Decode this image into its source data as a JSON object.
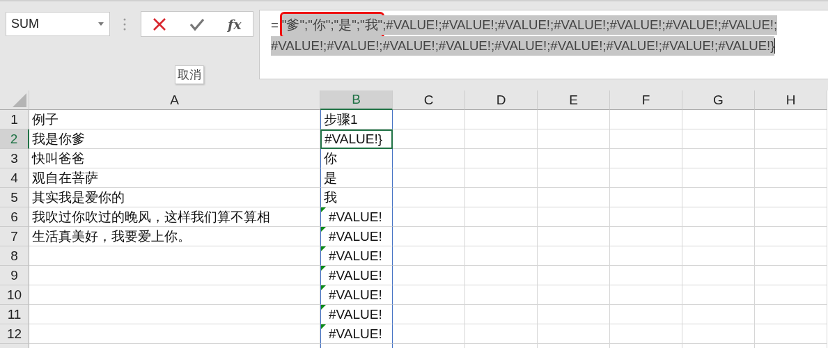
{
  "name_box": {
    "value": "SUM"
  },
  "formula_buttons": [
    {
      "kind": "cancel"
    },
    {
      "kind": "enter"
    },
    {
      "kind": "function",
      "label": "fx"
    }
  ],
  "tooltip": "取消",
  "formula_bar": {
    "prefix": "=",
    "boxed": "\"爹\";\"你\";\"是\";\"我\"",
    "lines": [
      ";#VALUE!;#VALUE!;#VALUE!;#VALUE!;#VALUE!;#VALUE!;#VALUE!;",
      "#VALUE!;#VALUE!;#VALUE!;#VALUE!;#VALUE!;#VALUE!;#VALUE!;#VALUE!;#VALUE!}"
    ]
  },
  "columns": [
    {
      "label": "A",
      "selected": false
    },
    {
      "label": "B",
      "selected": true
    },
    {
      "label": "C",
      "selected": false
    },
    {
      "label": "D",
      "selected": false
    },
    {
      "label": "E",
      "selected": false
    },
    {
      "label": "F",
      "selected": false
    },
    {
      "label": "G",
      "selected": false
    },
    {
      "label": "H",
      "selected": false
    }
  ],
  "rows": [
    {
      "label": "1",
      "selected": false,
      "a": "例子",
      "b": "步骤1",
      "b_active": false,
      "b_error_flag": false
    },
    {
      "label": "2",
      "selected": true,
      "a": "我是你爹",
      "b": "#VALUE!}",
      "b_active": true,
      "b_error_flag": false
    },
    {
      "label": "3",
      "selected": false,
      "a": "快叫爸爸",
      "b": "你",
      "b_active": false,
      "b_error_flag": false
    },
    {
      "label": "4",
      "selected": false,
      "a": "观自在菩萨",
      "b": "是",
      "b_active": false,
      "b_error_flag": false
    },
    {
      "label": "5",
      "selected": false,
      "a": "其实我是爱你的",
      "b": "我",
      "b_active": false,
      "b_error_flag": false
    },
    {
      "label": "6",
      "selected": false,
      "a": "我吹过你吹过的晚风，这样我们算不算相",
      "b": "#VALUE!",
      "b_active": false,
      "b_error_flag": true
    },
    {
      "label": "7",
      "selected": false,
      "a": "生活真美好，我要爱上你。",
      "b": "#VALUE!",
      "b_active": false,
      "b_error_flag": true
    },
    {
      "label": "8",
      "selected": false,
      "a": "",
      "b": "#VALUE!",
      "b_active": false,
      "b_error_flag": true
    },
    {
      "label": "9",
      "selected": false,
      "a": "",
      "b": "#VALUE!",
      "b_active": false,
      "b_error_flag": true
    },
    {
      "label": "10",
      "selected": false,
      "a": "",
      "b": "#VALUE!",
      "b_active": false,
      "b_error_flag": true
    },
    {
      "label": "11",
      "selected": false,
      "a": "",
      "b": "#VALUE!",
      "b_active": false,
      "b_error_flag": true
    },
    {
      "label": "12",
      "selected": false,
      "a": "",
      "b": "#VALUE!",
      "b_active": false,
      "b_error_flag": true
    }
  ]
}
